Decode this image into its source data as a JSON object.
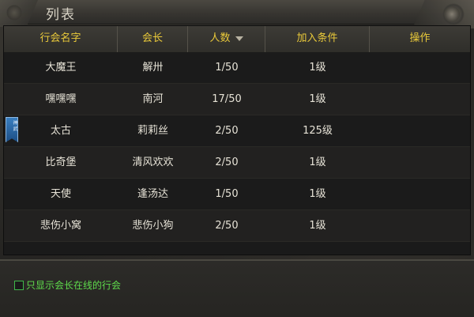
{
  "window": {
    "title": "列表"
  },
  "table": {
    "headers": {
      "guild_name": "行会名字",
      "leader": "会长",
      "members": "人数",
      "requirement": "加入条件",
      "action": "操作"
    },
    "rows": [
      {
        "name": "大魔王",
        "leader": "解卅",
        "members": "1/50",
        "requirement": "1级",
        "badge": false
      },
      {
        "name": "嘿嘿嘿",
        "leader": "南河",
        "members": "17/50",
        "requirement": "1级",
        "badge": false
      },
      {
        "name": "太古",
        "leader": "莉莉丝",
        "members": "2/50",
        "requirement": "125级",
        "badge": true,
        "badge_text": "神 武"
      },
      {
        "name": "比奇堡",
        "leader": "清风欢欢",
        "members": "2/50",
        "requirement": "1级",
        "badge": false
      },
      {
        "name": "天使",
        "leader": "逢汤达",
        "members": "1/50",
        "requirement": "1级",
        "badge": false
      },
      {
        "name": "悲伤小窝",
        "leader": "悲伤小狗",
        "members": "2/50",
        "requirement": "1级",
        "badge": false
      }
    ]
  },
  "footer": {
    "online_only_label": "只显示会长在线的行会",
    "online_only_checked": false
  },
  "colors": {
    "header_text": "#e9c93a",
    "body_text": "#e6e2d6",
    "checkbox_label": "#5fdc4c",
    "badge_blue": "#2a6aa8"
  }
}
